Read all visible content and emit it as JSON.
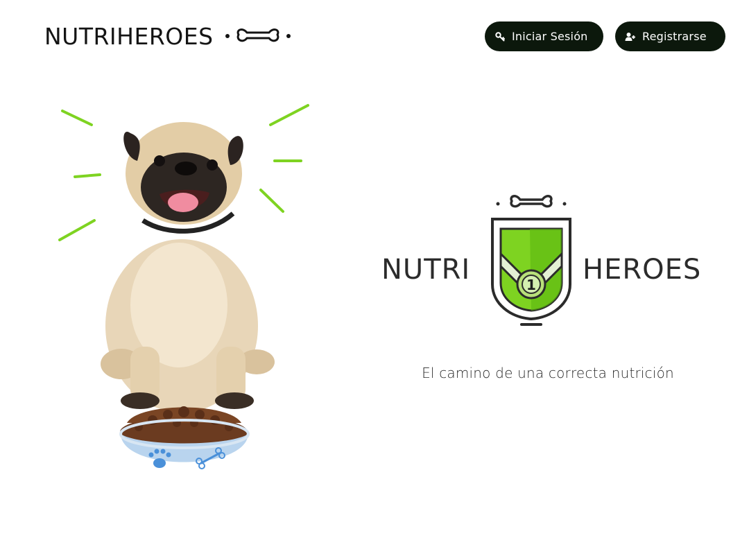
{
  "header": {
    "brand": "NUTRIHEROES",
    "buttons": {
      "login_label": "Iniciar Sesión",
      "register_label": "Registrarse"
    }
  },
  "logo": {
    "left_word": "NUTRI",
    "right_word": "HEROES",
    "medal_number": "1"
  },
  "tagline": "El camino de una correcta nutrición",
  "colors": {
    "accent_green": "#7ed321",
    "button_bg": "#0c180c",
    "text": "#1a1a1a"
  },
  "icons": {
    "brand": "bone-icon",
    "login": "key-icon",
    "register": "user-plus-icon"
  }
}
